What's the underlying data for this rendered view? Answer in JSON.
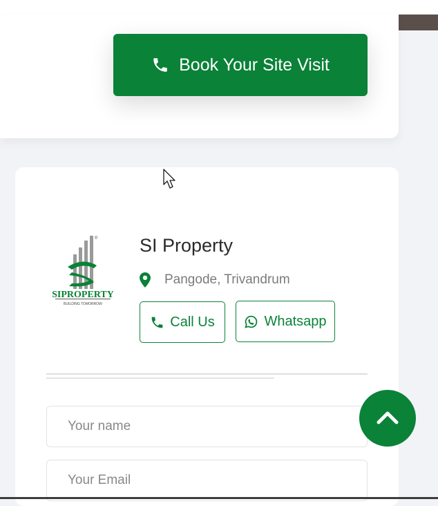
{
  "book_visit": {
    "label": "Book Your Site Visit",
    "icon": "phone-icon"
  },
  "agent": {
    "name": "SI Property",
    "location": "Pangode, Trivandrum",
    "location_icon": "map-marker-icon",
    "logo": {
      "wordmark": "SIPROPERTY",
      "tagline": "BUILDING TOMORROW"
    }
  },
  "contact_buttons": {
    "call_label": "Call Us",
    "whatsapp_label": "Whatsapp"
  },
  "form": {
    "name_placeholder": "Your name",
    "email_placeholder": "Your Email"
  },
  "colors": {
    "brand_green": "#0a8237",
    "text_dark": "#2a2a2a",
    "text_muted": "#7b7b7b",
    "background": "#f2f3f7"
  }
}
